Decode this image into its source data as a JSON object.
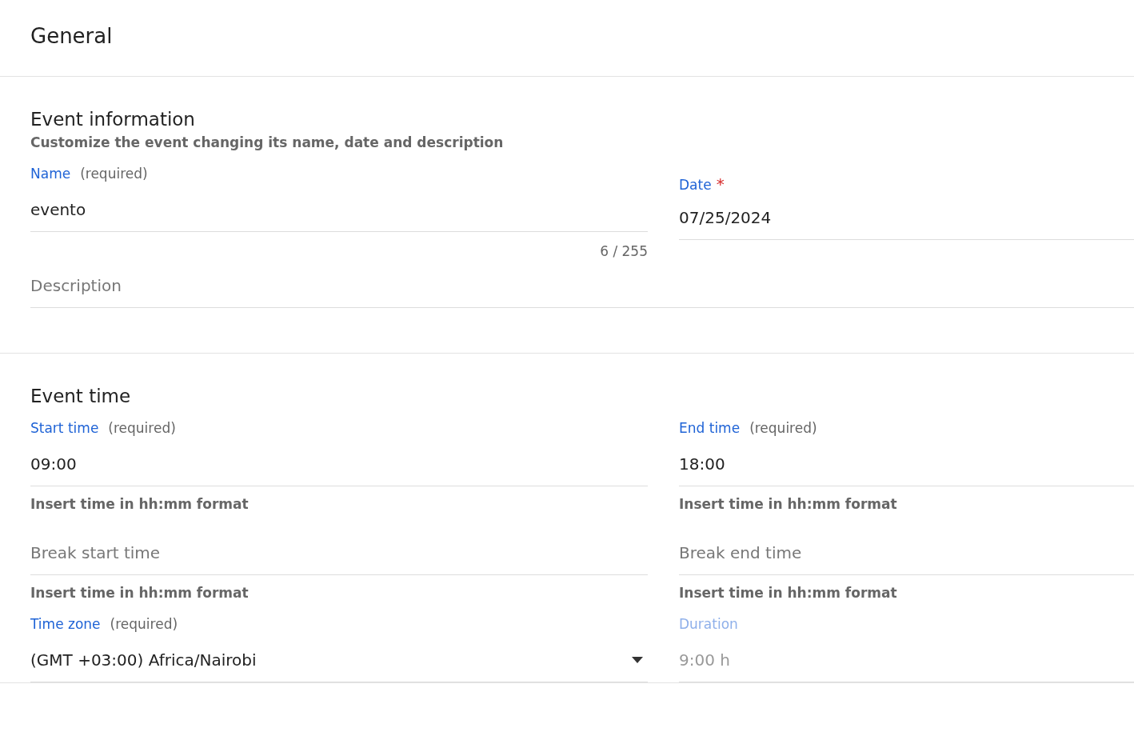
{
  "header": {
    "title": "General"
  },
  "sections": [
    {
      "title": "Event information",
      "subtitle": "Customize the event changing its name, date and description",
      "rows": [
        [
          {
            "kind": "text",
            "label": "Name",
            "required_note": "(required)",
            "value": "evento",
            "counter": "6 / 255"
          },
          {
            "kind": "date",
            "label": "Date",
            "required_mark": "*",
            "value": "07/25/2024"
          }
        ],
        [
          {
            "kind": "multiline",
            "placeholder": "Description"
          }
        ]
      ]
    },
    {
      "title": "Event time",
      "rows": [
        [
          {
            "kind": "text",
            "label": "Start time",
            "required_note": "(required)",
            "value": "09:00",
            "helper": "Insert time in hh:mm format"
          },
          {
            "kind": "text",
            "label": "End time",
            "required_note": "(required)",
            "value": "18:00",
            "helper": "Insert time in hh:mm format"
          }
        ],
        [
          {
            "kind": "text",
            "placeholder": "Break start time",
            "helper": "Insert time in hh:mm format"
          },
          {
            "kind": "text",
            "placeholder": "Break end time",
            "helper": "Insert time in hh:mm format"
          }
        ],
        [
          {
            "kind": "select",
            "label": "Time zone",
            "required_note": "(required)",
            "value": "(GMT +03:00) Africa/Nairobi"
          },
          {
            "kind": "text",
            "label": "Duration",
            "value": "9:00 h",
            "disabled": true
          }
        ]
      ]
    }
  ]
}
